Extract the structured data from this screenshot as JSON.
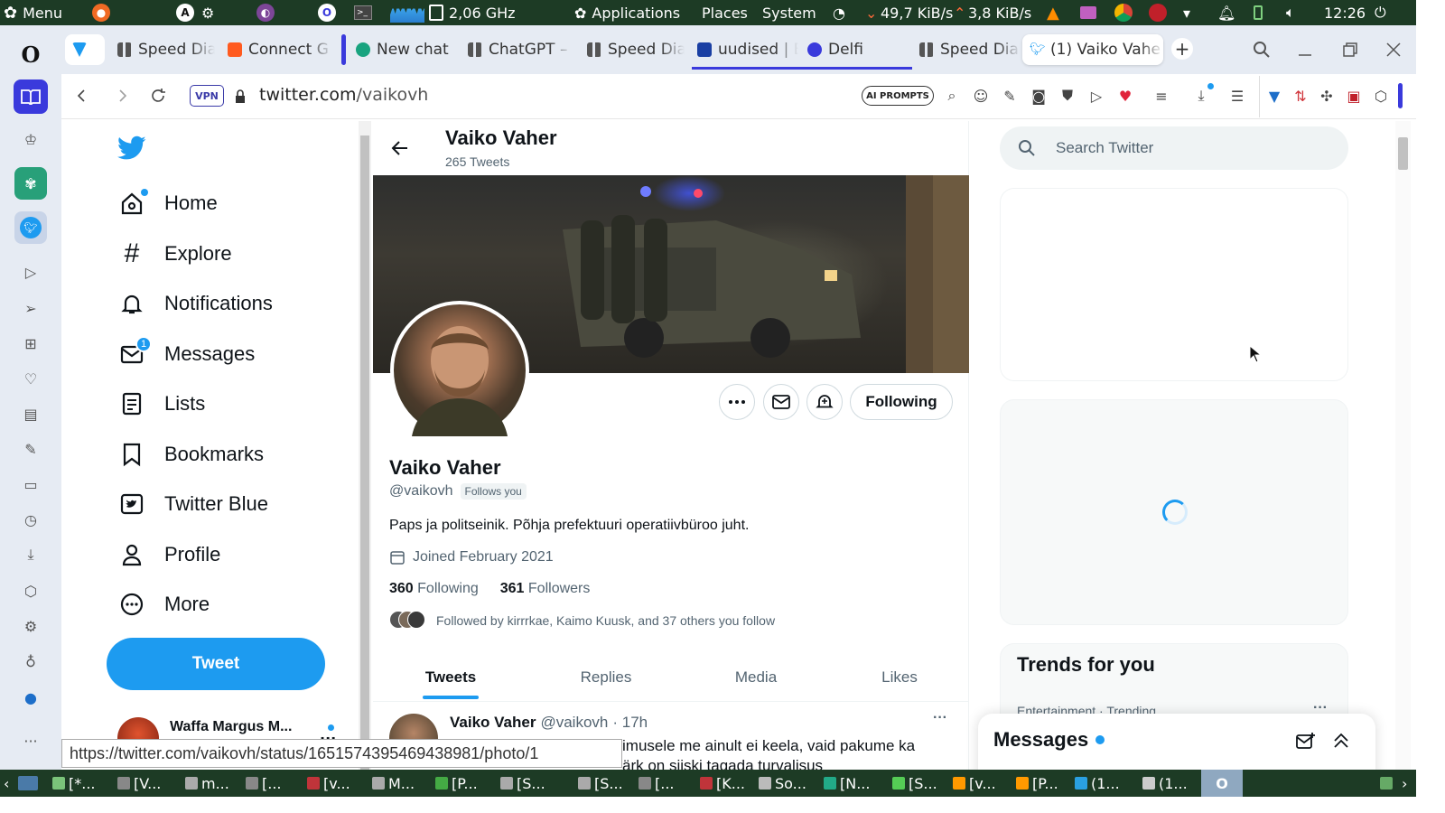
{
  "system_bar": {
    "menu_label": "Menu",
    "cpu_freq": "2,06 GHz",
    "applications": "Applications",
    "places": "Places",
    "system": "System",
    "net_down": "49,7 KiB/s",
    "net_up": "3,8 KiB/s",
    "clock": "12:26"
  },
  "browser": {
    "tabs": [
      {
        "label": "",
        "icon": "twitter-blue-shield-icon"
      },
      {
        "label": "Speed Dial",
        "icon": "speed-dial-icon"
      },
      {
        "label": "Connect G",
        "icon": "orange-square-icon"
      },
      {
        "label": "New chat",
        "icon": "chatgpt-icon"
      },
      {
        "label": "ChatGPT –",
        "icon": "speed-dial-icon"
      },
      {
        "label": "Speed Dia",
        "icon": "speed-dial-icon"
      },
      {
        "label": "uudised | E",
        "icon": "err-icon"
      },
      {
        "label": "Delfi",
        "icon": "delfi-icon"
      },
      {
        "label": "Speed Dia",
        "icon": "speed-dial-icon"
      },
      {
        "label": "(1) Vaiko Vahe",
        "icon": "twitter-icon"
      }
    ],
    "vpn_label": "VPN",
    "url_host": "twitter.com",
    "url_path": "/vaikovh",
    "ai_prompts_label": "AI PROMPTS",
    "status_url": "https://twitter.com/vaikovh/status/1651574395469438981/photo/1"
  },
  "twitter": {
    "nav": [
      {
        "label": "Home",
        "icon": "home-icon"
      },
      {
        "label": "Explore",
        "icon": "hashtag-icon"
      },
      {
        "label": "Notifications",
        "icon": "bell-icon"
      },
      {
        "label": "Messages",
        "icon": "envelope-icon",
        "badge": "1"
      },
      {
        "label": "Lists",
        "icon": "list-icon"
      },
      {
        "label": "Bookmarks",
        "icon": "bookmark-icon"
      },
      {
        "label": "Twitter Blue",
        "icon": "twitter-blue-icon"
      },
      {
        "label": "Profile",
        "icon": "person-icon"
      },
      {
        "label": "More",
        "icon": "more-circle-icon"
      }
    ],
    "tweet_button": "Tweet",
    "account_name": "Waffa Margus M...",
    "profile": {
      "header_name": "Vaiko Vaher",
      "header_count": "265 Tweets",
      "name": "Vaiko Vaher",
      "handle": "@vaikovh",
      "follows_you": "Follows you",
      "bio": "Paps ja politseinik. Põhja prefektuuri operatiivbüroo juht.",
      "joined": "Joined February 2021",
      "following_count": "360",
      "following_label": "Following",
      "followers_count": "361",
      "followers_label": "Followers",
      "followed_by": "Followed by kirrrkae, Kaimo Kuusk, and 37 others you follow",
      "following_button": "Following"
    },
    "tabs": [
      "Tweets",
      "Replies",
      "Media",
      "Likes"
    ],
    "tweet": {
      "name": "Vaiko Vaher",
      "handle": "@vaikovh",
      "time": "· 17h",
      "text_line1": "imusele me ainult ei keela, vaid pakume ka",
      "text_line2": "ärk on siiski tagada turvalisus"
    },
    "search_placeholder": "Search Twitter",
    "trends_title": "Trends for you",
    "trend_meta": "Entertainment · Trending",
    "messages_dock_title": "Messages"
  },
  "taskbar": {
    "items": [
      "[*...",
      "[V...",
      "m...",
      "[...",
      "[v...",
      "M...",
      "[P...",
      "[S...",
      "[S...",
      "[...",
      "[K...",
      "So...",
      "[N...",
      "[S...",
      "[v...",
      "[P...",
      "(1...",
      "(1..."
    ]
  },
  "colors": {
    "twitter_blue": "#1d9bf0",
    "system_bar": "#1d3b25",
    "opera_accent": "#3a3adc"
  }
}
